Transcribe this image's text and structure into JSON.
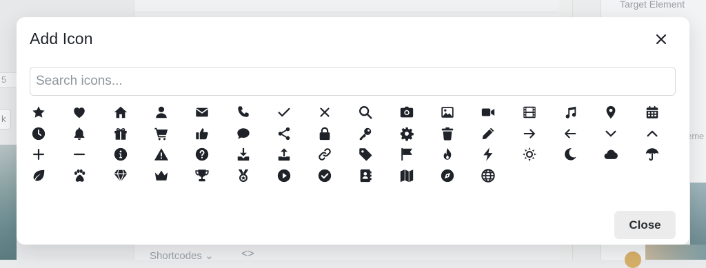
{
  "background": {
    "right_panel_label": "Target Element",
    "right_panel_label2": "eme",
    "left_strip_text": "5",
    "left_strip2_text": "k",
    "footer_label": "Shortcodes",
    "footer_chevron": "⌄",
    "footer_code_icon": "<>"
  },
  "modal": {
    "title": "Add Icon",
    "search_placeholder": "Search icons...",
    "close_button_label": "Close",
    "icons": [
      "star-icon",
      "heart-icon",
      "home-icon",
      "user-icon",
      "envelope-icon",
      "phone-icon",
      "check-icon",
      "times-icon",
      "search-icon",
      "camera-icon",
      "image-icon",
      "video-icon",
      "film-icon",
      "music-icon",
      "map-marker-icon",
      "calendar-icon",
      "clock-icon",
      "bell-icon",
      "gift-icon",
      "shopping-cart-icon",
      "thumbs-up-icon",
      "comment-icon",
      "share-icon",
      "lock-icon",
      "key-icon",
      "cog-icon",
      "trash-icon",
      "pencil-icon",
      "arrow-right-icon",
      "arrow-left-icon",
      "chevron-down-icon",
      "chevron-up-icon",
      "plus-icon",
      "minus-icon",
      "info-circle-icon",
      "warning-triangle-icon",
      "question-circle-icon",
      "download-icon",
      "upload-icon",
      "link-icon",
      "tag-icon",
      "flag-icon",
      "fire-icon",
      "bolt-icon",
      "sun-icon",
      "moon-icon",
      "cloud-icon",
      "umbrella-icon",
      "leaf-icon",
      "paw-icon",
      "gem-icon",
      "crown-icon",
      "trophy-icon",
      "medal-icon",
      "play-circle-icon",
      "check-circle-icon",
      "address-book-icon",
      "map-icon",
      "compass-icon",
      "globe-icon"
    ],
    "icon_color": "#1f2329"
  }
}
